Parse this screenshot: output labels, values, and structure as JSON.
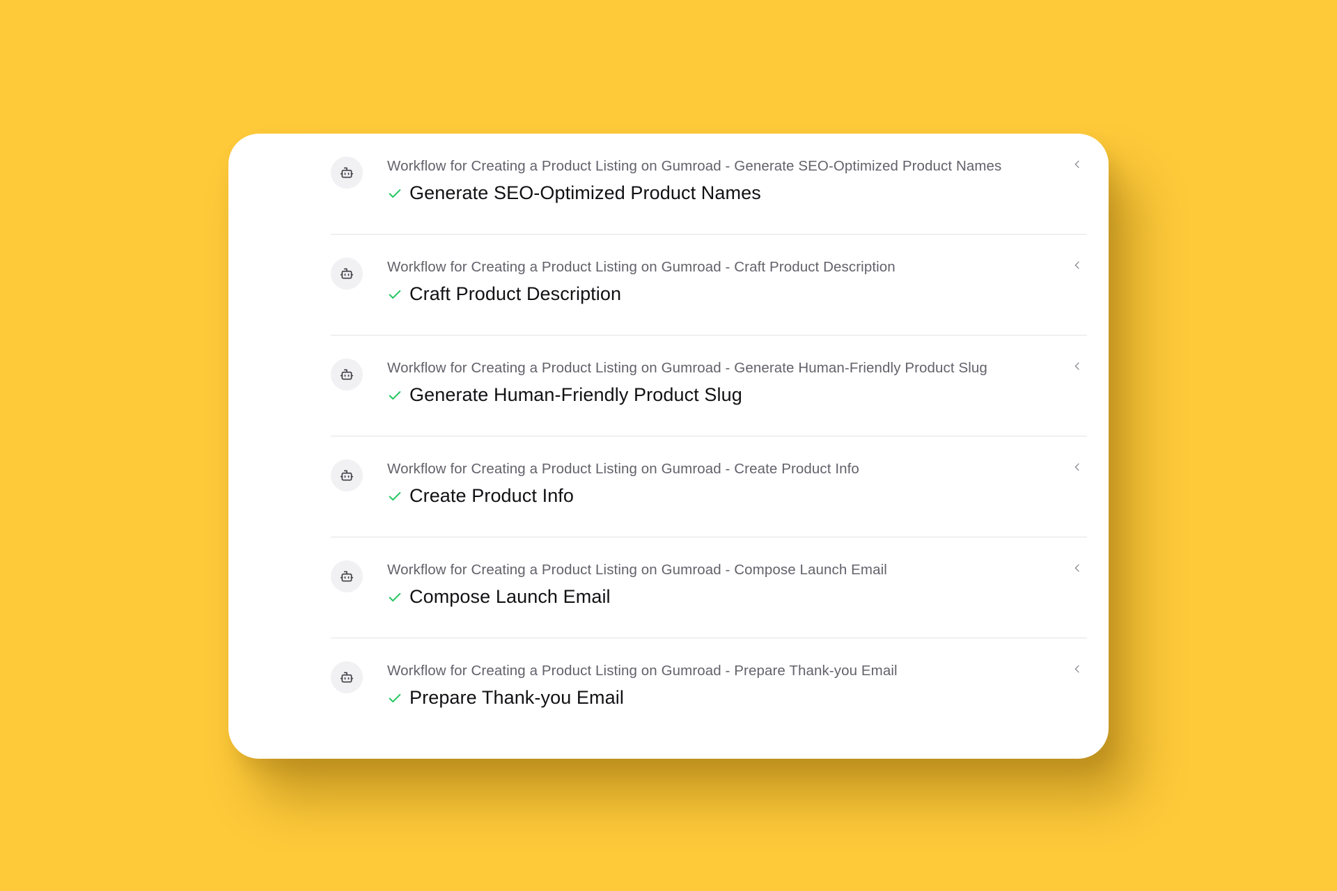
{
  "colors": {
    "background": "#FECA3A",
    "card": "#FFFFFF",
    "subtitle_text": "#62626B",
    "title_text": "#111114",
    "check": "#22C55E",
    "divider": "#E4E4E7",
    "avatar_bg": "#F1F1F3"
  },
  "steps": [
    {
      "icon": "bot-icon",
      "subtitle": "Workflow for Creating a Product Listing on Gumroad - Generate SEO-Optimized Product Names",
      "title": "Generate SEO-Optimized Product Names",
      "status_icon": "check-icon",
      "toggle_icon": "chevron-left-icon"
    },
    {
      "icon": "bot-icon",
      "subtitle": "Workflow for Creating a Product Listing on Gumroad - Craft Product Description",
      "title": "Craft Product Description",
      "status_icon": "check-icon",
      "toggle_icon": "chevron-left-icon"
    },
    {
      "icon": "bot-icon",
      "subtitle": "Workflow for Creating a Product Listing on Gumroad - Generate Human-Friendly Product Slug",
      "title": "Generate Human-Friendly Product Slug",
      "status_icon": "check-icon",
      "toggle_icon": "chevron-left-icon"
    },
    {
      "icon": "bot-icon",
      "subtitle": "Workflow for Creating a Product Listing on Gumroad - Create Product Info",
      "title": "Create Product Info",
      "status_icon": "check-icon",
      "toggle_icon": "chevron-left-icon"
    },
    {
      "icon": "bot-icon",
      "subtitle": "Workflow for Creating a Product Listing on Gumroad - Compose Launch Email",
      "title": "Compose Launch Email",
      "status_icon": "check-icon",
      "toggle_icon": "chevron-left-icon"
    },
    {
      "icon": "bot-icon",
      "subtitle": "Workflow for Creating a Product Listing on Gumroad - Prepare Thank-you Email",
      "title": "Prepare Thank-you Email",
      "status_icon": "check-icon",
      "toggle_icon": "chevron-left-icon"
    }
  ]
}
